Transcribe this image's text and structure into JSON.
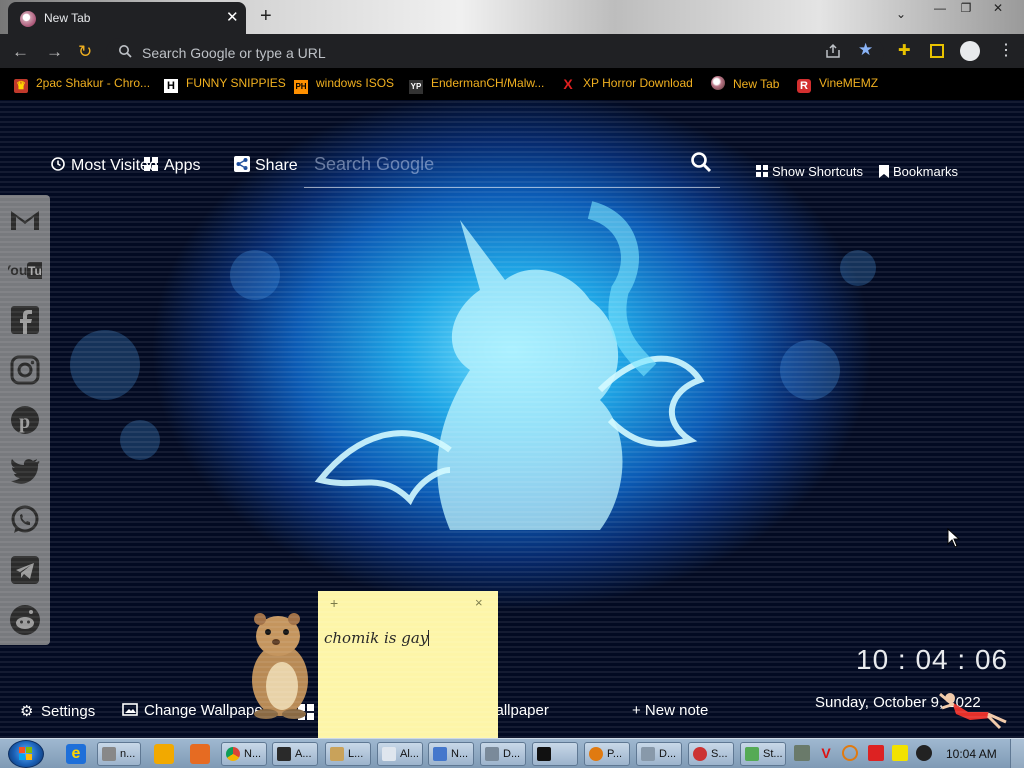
{
  "browser": {
    "tab_title": "New Tab",
    "new_tab_label": "+",
    "omnibox_placeholder": "Search Google or type a URL",
    "bookmarks": [
      {
        "label": "2pac Shakur - Chro...",
        "icon": "crown-icon"
      },
      {
        "label": "FUNNY SNIPPIES",
        "icon": "H"
      },
      {
        "label": "windows ISOS",
        "icon": "PH"
      },
      {
        "label": "EndermanCH/Malw...",
        "icon": "YP"
      },
      {
        "label": "XP Horror Download",
        "icon": "X"
      },
      {
        "label": "New Tab",
        "icon": "globe-icon"
      },
      {
        "label": "VineMEMZ",
        "icon": "R"
      }
    ]
  },
  "ntp": {
    "most_visited": "Most Visited",
    "apps": "Apps",
    "share": "Share",
    "search_placeholder": "Search Google",
    "show_shortcuts": "Show Shortcuts",
    "bookmarks": "Bookmarks",
    "settings": "Settings",
    "change_wallpaper": "Change Wallpaper",
    "download_wallpaper": "Download Wallpaper",
    "new_note": "+ New note",
    "clock": "10 : 04 : 06",
    "date": "Sunday, October 9, 2022",
    "social": [
      "gmail-icon",
      "youtube-icon",
      "facebook-icon",
      "instagram-icon",
      "pinterest-icon",
      "twitter-icon",
      "whatsapp-icon",
      "telegram-icon",
      "reddit-icon"
    ]
  },
  "note": {
    "add": "+",
    "close": "×",
    "text": "chomik is gay"
  },
  "taskbar": {
    "tasks": [
      "n...",
      "N...",
      "A...",
      "L...",
      "Al...",
      "N...",
      "D...",
      "",
      "P...",
      "D...",
      "S...",
      "St..."
    ],
    "time": "10:04 AM"
  },
  "colors": {
    "bookmark_text": "#f0b020",
    "toolbar_bg": "#202124",
    "accent_star": "#8ab4f8",
    "note_bg": "#fdf5a8"
  }
}
